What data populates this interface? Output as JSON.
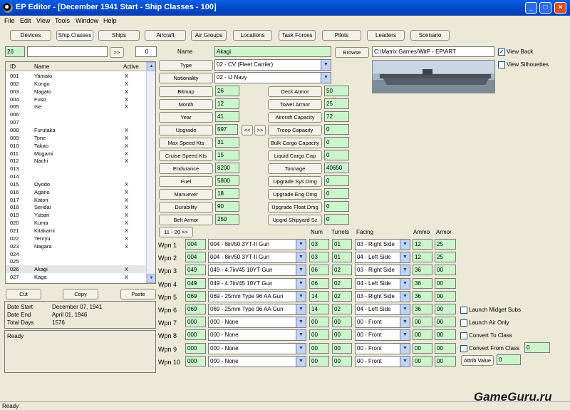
{
  "window": {
    "title": "EP Editor - [December 1941 Start - Ship Classes - 100]",
    "controls": [
      "_",
      "□",
      "×"
    ]
  },
  "menu": [
    "File",
    "Edit",
    "View",
    "Tools",
    "Window",
    "Help"
  ],
  "tabs": [
    "Devices",
    "Ship Classes",
    "Ships",
    "Aircraft",
    "Air Groups",
    "Locations",
    "Task Forces",
    "Pilots",
    "Leaders",
    "Scenario"
  ],
  "nav": {
    "current": "26",
    "search": "",
    "go_label": ">>",
    "count": "0"
  },
  "list": {
    "headers": [
      "ID",
      "Name",
      "Active"
    ],
    "rows": [
      [
        "001",
        "Yamato",
        "X"
      ],
      [
        "002",
        "Kongo",
        "X"
      ],
      [
        "003",
        "Nagato",
        "X"
      ],
      [
        "004",
        "Fuso",
        "X"
      ],
      [
        "005",
        "Ise",
        "X"
      ],
      [
        "006",
        "",
        ""
      ],
      [
        "007",
        "",
        ""
      ],
      [
        "008",
        "Furutaka",
        "X"
      ],
      [
        "009",
        "Tone",
        "X"
      ],
      [
        "010",
        "Takao",
        "X"
      ],
      [
        "011",
        "Mogami",
        "X"
      ],
      [
        "012",
        "Nachi",
        "X"
      ],
      [
        "013",
        "",
        ""
      ],
      [
        "014",
        "",
        ""
      ],
      [
        "015",
        "Oyodo",
        "X"
      ],
      [
        "016",
        "Agano",
        "X"
      ],
      [
        "017",
        "Katori",
        "X"
      ],
      [
        "018",
        "Sendai",
        "X"
      ],
      [
        "019",
        "Yubari",
        "X"
      ],
      [
        "020",
        "Kuma",
        "X"
      ],
      [
        "021",
        "Kitakami",
        "X"
      ],
      [
        "022",
        "Tenryu",
        "X"
      ],
      [
        "023",
        "Nagara",
        "X"
      ],
      [
        "024",
        "",
        ""
      ],
      [
        "025",
        "",
        ""
      ],
      [
        "026",
        "Akagi",
        "X"
      ],
      [
        "027",
        "Kaga",
        "X"
      ]
    ]
  },
  "scroll": {
    "up": "▲",
    "down": "▼"
  },
  "edit_buttons": [
    "Cut",
    "Copy",
    "Paste"
  ],
  "dates": {
    "start_label": "Date Start",
    "start": "December 07, 1941",
    "end_label": "Date End",
    "end": "April 01, 1946",
    "days_label": "Total Days",
    "days": "1576"
  },
  "status_panel": "Ready",
  "name": {
    "label": "Name",
    "value": "Akagi"
  },
  "browse": {
    "label": "Browse",
    "path": "C:\\Matrix Games\\WitP - EP\\ART"
  },
  "view": {
    "back_label": "View Back",
    "back_checked": true,
    "silhouettes_label": "View Silhouettes",
    "silhouettes_checked": false
  },
  "type": {
    "label": "Type",
    "value": "02 - CV (Fleet Carrier)"
  },
  "nationality": {
    "label": "Nationality",
    "value": "02 - IJ Navy"
  },
  "left_fields": [
    {
      "label": "Bitmap",
      "value": "26"
    },
    {
      "label": "Month",
      "value": "12"
    },
    {
      "label": "Year",
      "value": "41"
    },
    {
      "label": "Upgrade",
      "value": "597"
    },
    {
      "label": "Max Speed Kts",
      "value": "31"
    },
    {
      "label": "Cruise Speed Kts",
      "value": "15"
    },
    {
      "label": "Endurance",
      "value": "8200"
    },
    {
      "label": "Fuel",
      "value": "5800"
    },
    {
      "label": "Manuever",
      "value": "18"
    },
    {
      "label": "Durability",
      "value": "90"
    },
    {
      "label": "Belt Armor",
      "value": "250"
    }
  ],
  "upgrade_nav": {
    "prev": "<<",
    "next": ">>"
  },
  "right_fields": [
    {
      "label": "Deck Armor",
      "value": "50"
    },
    {
      "label": "Tower Armor",
      "value": "25"
    },
    {
      "label": "Aircraft Capacity",
      "value": "72"
    },
    {
      "label": "Troop Capacity",
      "value": "0"
    },
    {
      "label": "Bulk Cargo Capacity",
      "value": "0"
    },
    {
      "label": "Liquid Cargo Cap",
      "value": "0"
    },
    {
      "label": "Tonnage",
      "value": "40650"
    },
    {
      "label": "Upgrade Sys Dmg",
      "value": "0"
    },
    {
      "label": "Upgrade Eng Dmg",
      "value": "0"
    },
    {
      "label": "Upgrade Float Dmg",
      "value": "0"
    },
    {
      "label": "Upgrd Shipyard Sz",
      "value": "0"
    }
  ],
  "weapons": {
    "page_button": "11 - 20 >>",
    "headers": {
      "num": "Num",
      "turrets": "Turrets",
      "facing": "Facing",
      "ammo": "Ammo",
      "armor": "Armor"
    },
    "rows": [
      {
        "label": "Wpn 1",
        "code": "004",
        "device": "004 - 8in/50 3YT-II Gun",
        "num": "03",
        "turrets": "01",
        "facing": "03 - Right Side",
        "ammo": "12",
        "armor": "25"
      },
      {
        "label": "Wpn 2",
        "code": "004",
        "device": "004 - 8in/50 3YT-II Gun",
        "num": "03",
        "turrets": "01",
        "facing": "04 - Left Side",
        "ammo": "12",
        "armor": "25"
      },
      {
        "label": "Wpn 3",
        "code": "049",
        "device": "049 - 4.7in/45 10YT Gun",
        "num": "06",
        "turrets": "02",
        "facing": "03 - Right Side",
        "ammo": "36",
        "armor": "00"
      },
      {
        "label": "Wpn 4",
        "code": "049",
        "device": "049 - 4.7in/45 10YT Gun",
        "num": "06",
        "turrets": "02",
        "facing": "04 - Left Side",
        "ammo": "36",
        "armor": "00"
      },
      {
        "label": "Wpn 5",
        "code": "069",
        "device": "069 - 25mm Type 96 AA Gun",
        "num": "14",
        "turrets": "02",
        "facing": "03 - Right Side",
        "ammo": "36",
        "armor": "00"
      },
      {
        "label": "Wpn 6",
        "code": "069",
        "device": "069 - 25mm Type 96 AA Gun",
        "num": "14",
        "turrets": "02",
        "facing": "04 - Left Side",
        "ammo": "36",
        "armor": "00"
      },
      {
        "label": "Wpn 7",
        "code": "000",
        "device": "000 - None",
        "num": "00",
        "turrets": "00",
        "facing": "00 - Front",
        "ammo": "00",
        "armor": "00"
      },
      {
        "label": "Wpn 8",
        "code": "000",
        "device": "000 - None",
        "num": "00",
        "turrets": "00",
        "facing": "00 - Front",
        "ammo": "00",
        "armor": "00"
      },
      {
        "label": "Wpn 9",
        "code": "000",
        "device": "000 - None",
        "num": "00",
        "turrets": "00",
        "facing": "00 - Front",
        "ammo": "00",
        "armor": "00"
      },
      {
        "label": "Wpn 10",
        "code": "000",
        "device": "000 - None",
        "num": "00",
        "turrets": "00",
        "facing": "00 - Front",
        "ammo": "00",
        "armor": "00"
      }
    ]
  },
  "options": {
    "midget_subs": "Launch Midget Subs",
    "air_only": "Launch Air Only",
    "convert_to": "Convert To Class",
    "convert_from": "Convert From Class",
    "convert_from_value": "0",
    "attrib_label": "Attrib Value",
    "attrib_value": "0"
  },
  "watermark": "GameGuru.ru",
  "statusbar": "Ready"
}
